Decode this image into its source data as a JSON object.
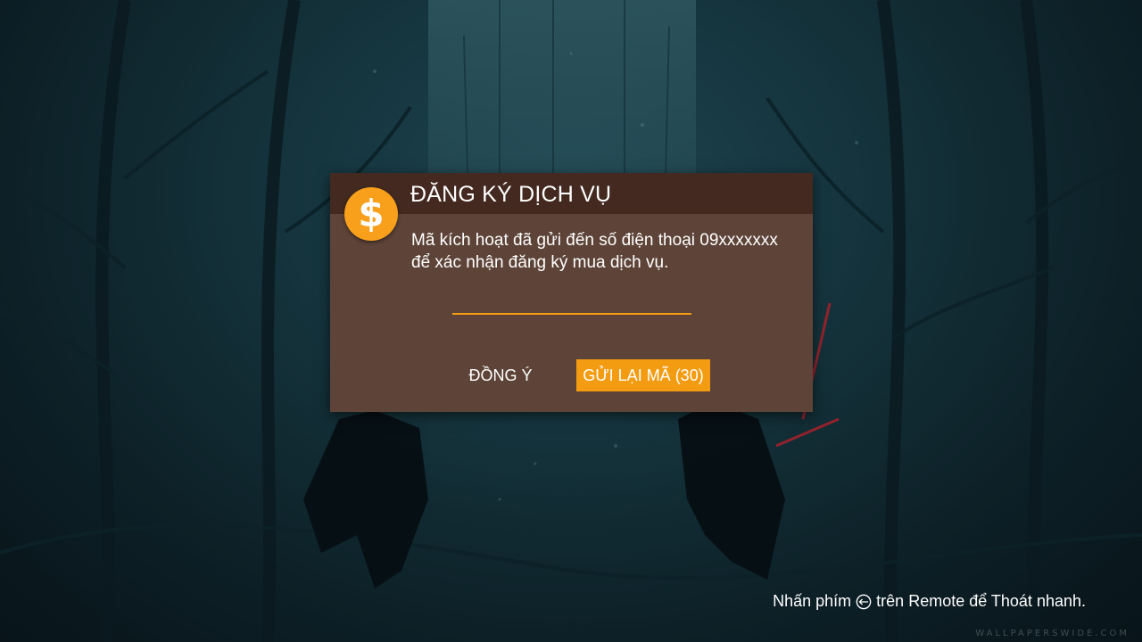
{
  "dialog": {
    "title": "ĐĂNG KÝ DỊCH VỤ",
    "icon": "dollar-sign-icon",
    "icon_symbol": "$",
    "message_line1": "Mã kích hoạt đã gửi đến số điện thoại 09xxxxxxx",
    "message_line2": "để xác nhận đăng ký mua dịch vụ.",
    "code_input_value": "",
    "agree_label": "ĐỒNG Ý",
    "resend_label": "GỬI LẠI MÃ (30)"
  },
  "footer": {
    "hint_prefix": "Nhấn phím",
    "hint_icon": "back-key-icon",
    "hint_suffix": "trên Remote để Thoát nhanh."
  },
  "background": {
    "watermark": "WALLPAPERSWIDE.COM"
  },
  "colors": {
    "dialog_bg": "#5e4438",
    "dialog_header_bg": "#43291f",
    "accent": "#f39c12",
    "badge": "#f8a01c"
  }
}
